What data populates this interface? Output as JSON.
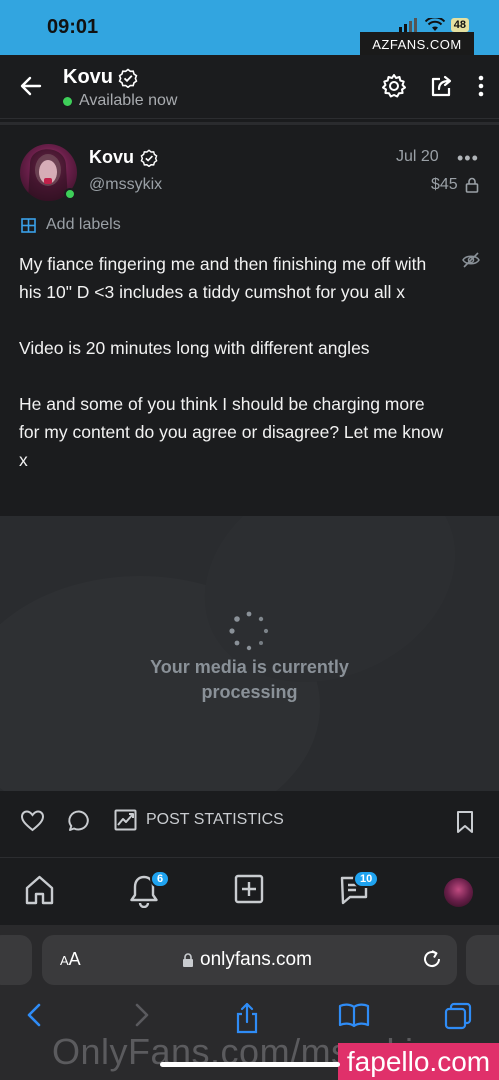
{
  "status_bar": {
    "time": "09:01",
    "battery": "48",
    "watermark": "AZFANS.COM"
  },
  "header": {
    "name": "Kovu",
    "status": "Available now"
  },
  "post": {
    "name": "Kovu",
    "handle": "@mssykix",
    "date": "Jul 20",
    "more": "•••",
    "price": "$45",
    "labels_action": "Add labels",
    "text_p1": "My fiance fingering me and then finishing me off with his 10\" D <3 includes a tiddy cumshot for you all x",
    "text_p2": "Video is 20 minutes long with different angles",
    "text_p3": "He and some of you think I should be charging more for my content do you agree or disagree? Let me know x"
  },
  "media": {
    "line1": "Your media is currently",
    "line2": "processing"
  },
  "actions": {
    "stats_label": "POST STATISTICS"
  },
  "bottom_nav": {
    "notifications_badge": "6",
    "messages_badge": "10"
  },
  "browser": {
    "aa_label_small": "A",
    "aa_label_big": "A",
    "url": "onlyfans.com",
    "watermark_text": "OnlyFans.com/mssykix",
    "fapello": "fapello.com"
  },
  "colors": {
    "accent": "#1fa3f0",
    "online": "#3ecf59",
    "status_bar": "#32a5e0"
  }
}
